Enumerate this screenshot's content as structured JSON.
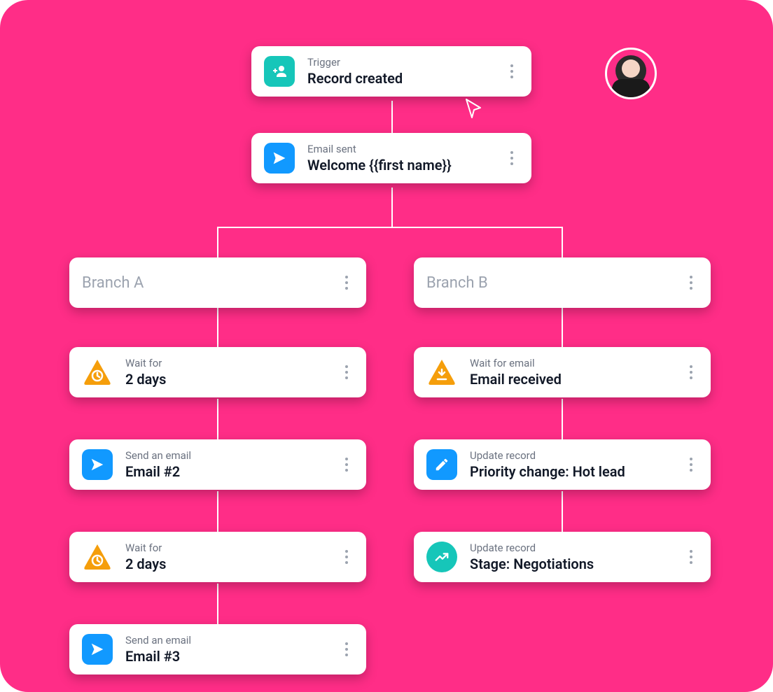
{
  "colors": {
    "teal": "#16c6b9",
    "blue": "#1199ff",
    "orange": "#f59e0b"
  },
  "avatar": {
    "alt": "user-avatar"
  },
  "trigger": {
    "label": "Trigger",
    "title": "Record created",
    "icon": "person-add"
  },
  "step_email": {
    "label": "Email sent",
    "title": "Welcome {{first name}}",
    "icon": "send"
  },
  "branch_a": {
    "label": "Branch A",
    "steps": [
      {
        "label": "Wait for",
        "title": "2 days",
        "icon": "wait-clock"
      },
      {
        "label": "Send an email",
        "title": "Email #2",
        "icon": "send"
      },
      {
        "label": "Wait for",
        "title": "2 days",
        "icon": "wait-clock"
      },
      {
        "label": "Send an email",
        "title": "Email #3",
        "icon": "send"
      }
    ]
  },
  "branch_b": {
    "label": "Branch B",
    "steps": [
      {
        "label": "Wait for email",
        "title": "Email received",
        "icon": "wait-download"
      },
      {
        "label": "Update record",
        "title": "Priority change: Hot lead",
        "icon": "edit"
      },
      {
        "label": "Update record",
        "title": "Stage: Negotiations",
        "icon": "trend"
      }
    ]
  }
}
